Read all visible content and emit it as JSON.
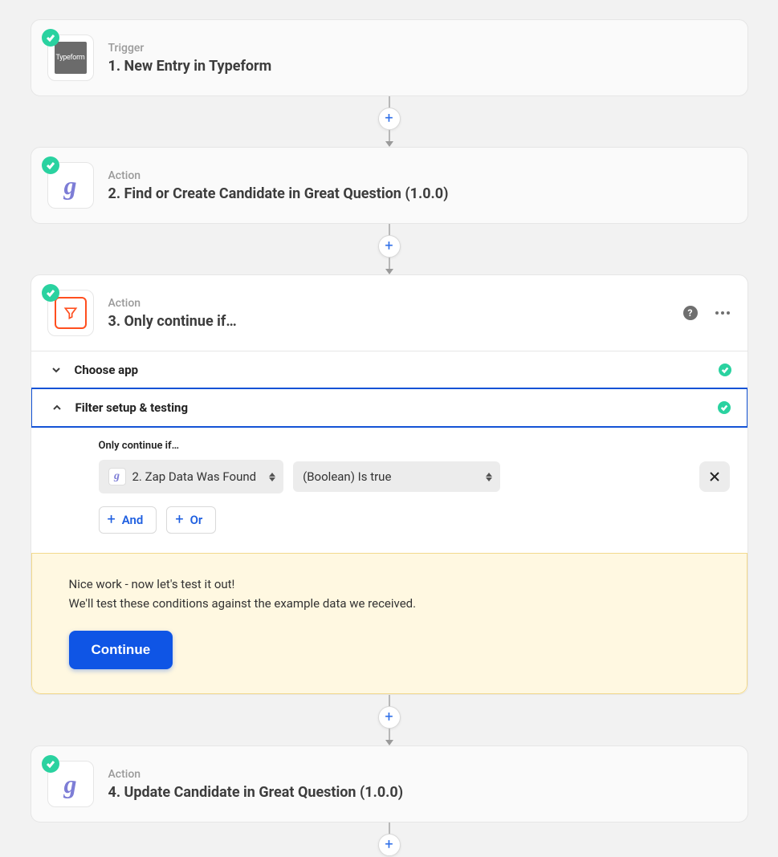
{
  "steps": [
    {
      "type": "Trigger",
      "title": "1. New Entry in Typeform",
      "icon": "typeform",
      "iconText": "Typeform",
      "state": "complete"
    },
    {
      "type": "Action",
      "title": "2. Find or Create Candidate in Great Question (1.0.0)",
      "icon": "gq",
      "iconText": "g",
      "state": "complete"
    },
    {
      "type": "Action",
      "title": "3. Only continue if…",
      "icon": "filter",
      "state": "complete",
      "expanded": true
    },
    {
      "type": "Action",
      "title": "4. Update Candidate in Great Question (1.0.0)",
      "icon": "gq",
      "iconText": "g",
      "state": "complete"
    }
  ],
  "expandedStep": {
    "sections": {
      "chooseApp": {
        "label": "Choose app",
        "complete": true
      },
      "filterSetup": {
        "label": "Filter setup & testing",
        "complete": true
      }
    },
    "filter": {
      "label": "Only continue if…",
      "fieldIconText": "g",
      "fieldText": "2. Zap Data Was Found",
      "conditionText": "(Boolean) Is true",
      "andLabel": "And",
      "orLabel": "Or"
    },
    "test": {
      "line1": "Nice work - now let's test it out!",
      "line2": "We'll test these conditions against the example data we received.",
      "button": "Continue"
    }
  }
}
